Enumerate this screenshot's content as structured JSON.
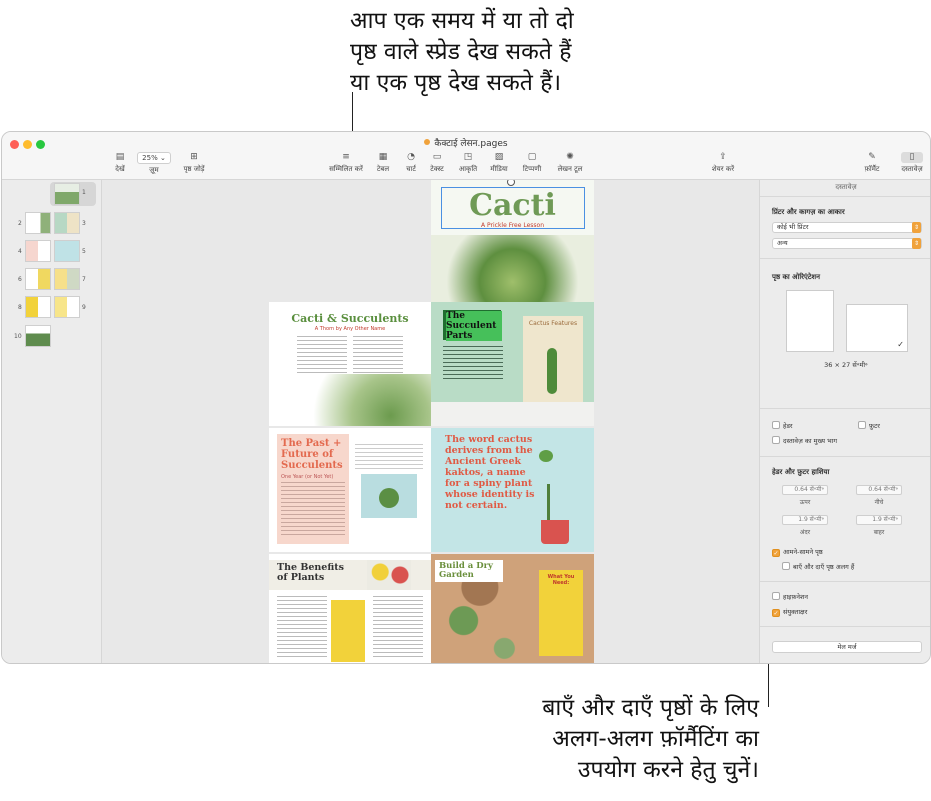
{
  "callouts": {
    "top": [
      "आप एक समय में या तो दो",
      "पृष्ठ वाले स्प्रेड देख सकते हैं",
      "या एक पृष्ठ देख सकते हैं।"
    ],
    "bottom": [
      "बाएँ और दाएँ पृष्ठों के लिए",
      "अलग-अलग फ़ॉर्मैटिंग का",
      "उपयोग करने हेतु चुनें।"
    ]
  },
  "window": {
    "title": "कैक्टाई लेसन.pages",
    "title_dot_color": "#f0a23b",
    "traffic_lights": [
      "#fe5f57",
      "#febc2e",
      "#28c840"
    ]
  },
  "toolbar": {
    "view_label": "देखें",
    "zoom_value": "25%",
    "zoom_label": "ज़ूम",
    "add_page_label": "पृष्ठ जोड़ें",
    "insert_label": "सम्मिलित करें",
    "table_label": "टेबल",
    "chart_label": "चार्ट",
    "text_label": "टेक्स्ट",
    "shape_label": "आकृति",
    "media_label": "मीडिया",
    "comment_label": "टिप्पणी",
    "collab_label": "लेखन टूल",
    "share_label": "शेयर करें",
    "format_label": "फ़ॉर्मैट",
    "document_label": "दस्तावेज़"
  },
  "sidebar": {
    "page_numbers": [
      "1",
      "2",
      "3",
      "4",
      "5",
      "6",
      "7",
      "8",
      "9",
      "10"
    ]
  },
  "pages": {
    "cover_title": "Cacti",
    "cover_subtitle": "A Prickle Free Lesson",
    "p2_title": "Cacti & Succulents",
    "p2_subtitle": "A Thorn by Any Other Name",
    "p3_title": "The Succulent Parts",
    "p3_note": "Cactus Features",
    "p4_title": "The Past + Future of Succulents",
    "p4_sub": "One Year (or Not Yet)",
    "p5_text": "The word cactus derives from the Ancient Greek kaktos, a name for a spiny plant whose identity is not certain.",
    "p6_title": "The Benefits of Plants",
    "p7_title": "Build a Dry Garden",
    "p7_card": "What You Need:"
  },
  "inspector": {
    "header": "दस्तावेज़",
    "printer_paper_label": "प्रिंटर और कागज़ का आकार",
    "printer_value": "कोई भी प्रिंटर",
    "paper_value": "अन्य",
    "orientation_label": "पृष्ठ का ओरिएंटेशन",
    "size_text": "36 × 27 सें॰मी॰",
    "header_label": "हेडर",
    "footer_label": "फ़ुटर",
    "body_label": "दस्तावेज़ का मुख्य भाग",
    "margins_label": "हेडर और फ़ुटर हाशिया",
    "top_value": "0.64 सें॰मी॰",
    "top_label": "ऊपर",
    "bottom_value": "0.64 सें॰मी॰",
    "bottom_label": "नीचे",
    "inside_value": "1.9 सें॰मी॰",
    "inside_label": "अंदर",
    "outside_value": "1.9 सें॰मी॰",
    "outside_label": "बाहर",
    "facing_pages_label": "आमने-सामने पृष्ठ",
    "left_right_label": "बाएँ और दाएँ पृष्ठ अलग हैं",
    "hyphenation_label": "हाइफ़नेशन",
    "ligatures_label": "संयुक्ताक्षर",
    "mail_merge_label": "मेल मर्ज",
    "accent_color": "#f0a23b"
  }
}
